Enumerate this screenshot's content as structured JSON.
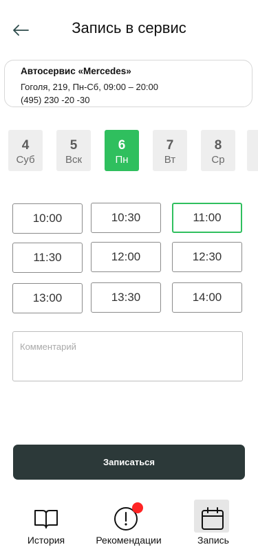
{
  "header": {
    "title": "Запись в сервис",
    "back_icon": "arrow-left-icon"
  },
  "service": {
    "name": "Автосервис «Mercedes»",
    "address_hours": "Гоголя, 219, Пн-Сб, 09:00 – 20:00",
    "phone": "(495) 230 -20 -30"
  },
  "days": [
    {
      "num": "4",
      "dow": "Суб",
      "active": false
    },
    {
      "num": "5",
      "dow": "Вск",
      "active": false
    },
    {
      "num": "6",
      "dow": "Пн",
      "active": true
    },
    {
      "num": "7",
      "dow": "Вт",
      "active": false
    },
    {
      "num": "8",
      "dow": "Ср",
      "active": false
    }
  ],
  "slots": [
    {
      "time": "10:00",
      "selected": false
    },
    {
      "time": "10:30",
      "selected": false
    },
    {
      "time": "11:00",
      "selected": true
    },
    {
      "time": "11:30",
      "selected": false
    },
    {
      "time": "12:00",
      "selected": false
    },
    {
      "time": "12:30",
      "selected": false
    },
    {
      "time": "13:00",
      "selected": false
    },
    {
      "time": "13:30",
      "selected": false
    },
    {
      "time": "14:00",
      "selected": false
    }
  ],
  "comment": {
    "placeholder": "Комментарий",
    "value": ""
  },
  "submit_label": "Записаться",
  "tabbar": [
    {
      "label": "История",
      "icon": "book-icon",
      "active": false
    },
    {
      "label": "Рекомендации",
      "icon": "alert-circle-icon",
      "active": false,
      "badge": true
    },
    {
      "label": "Запись",
      "icon": "calendar-icon",
      "active": true
    }
  ],
  "colors": {
    "accent": "#2fbf5e",
    "button": "#2c3939",
    "badge": "#ff2424",
    "day_bg": "#eeeeee"
  }
}
